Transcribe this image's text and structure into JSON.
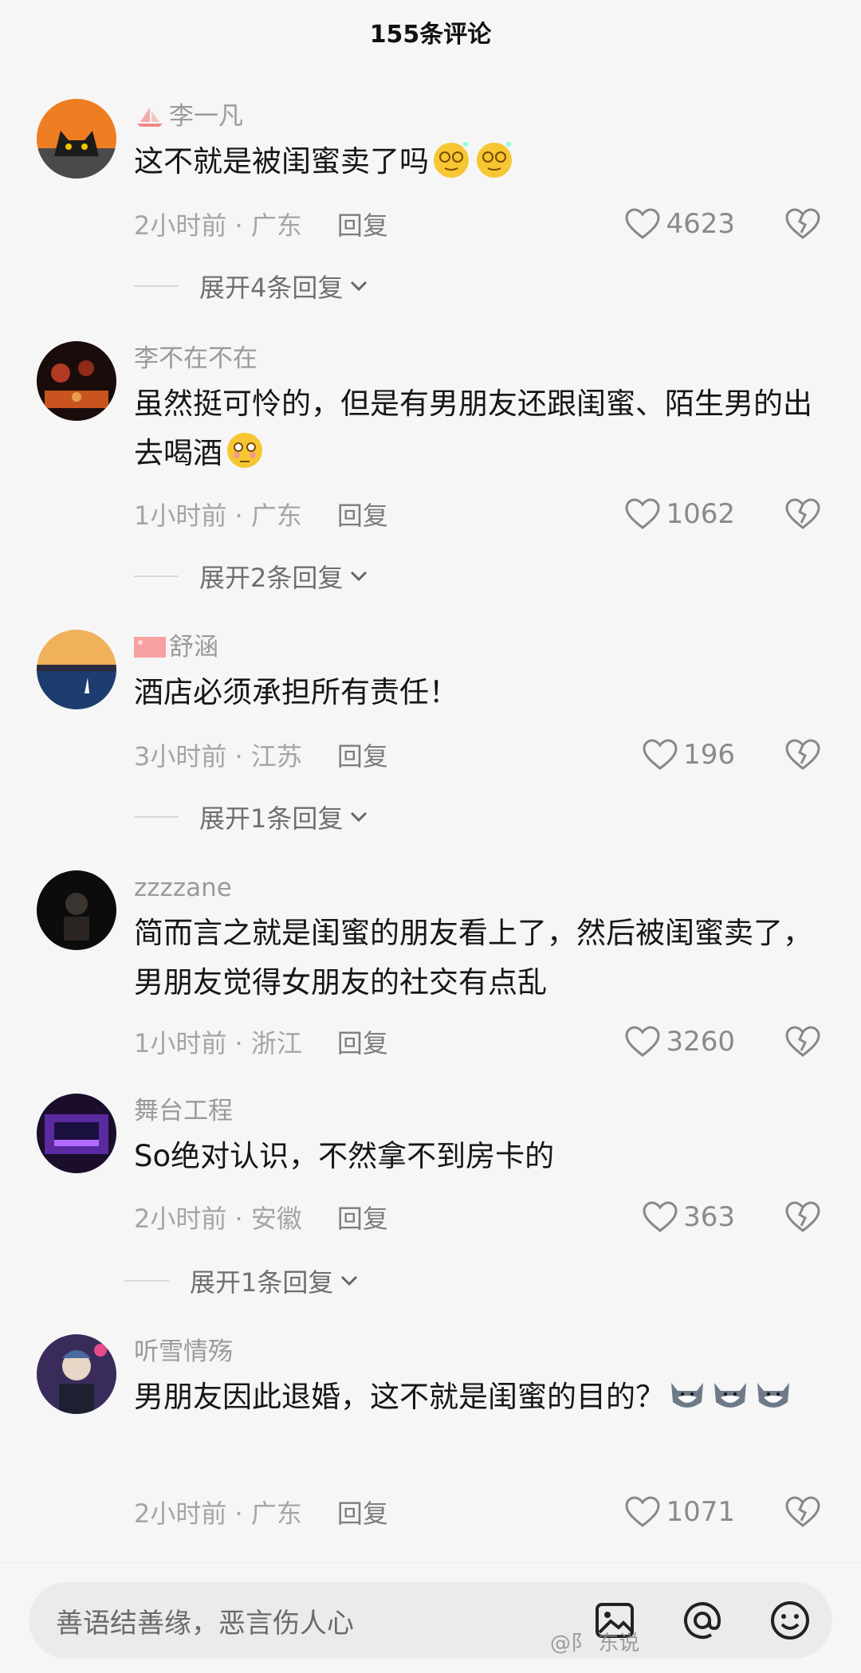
{
  "header": {
    "title": "155条评论"
  },
  "comments": [
    {
      "username": "李一凡",
      "text": "这不就是被闺蜜卖了吗",
      "time": "2小时前 · 广东",
      "reply": "回复",
      "likes": "4623",
      "expand": "展开4条回复"
    },
    {
      "username": "李不在不在",
      "text": "虽然挺可怜的，但是有男朋友还跟闺蜜、陌生男的出去喝酒",
      "time": "1小时前 · 广东",
      "reply": "回复",
      "likes": "1062",
      "expand": "展开2条回复"
    },
    {
      "username": "舒涵",
      "text": "酒店必须承担所有责任！",
      "time": "3小时前 · 江苏",
      "reply": "回复",
      "likes": "196",
      "expand": "展开1条回复"
    },
    {
      "username": "zzzzane",
      "text": "简而言之就是闺蜜的朋友看上了，然后被闺蜜卖了，男朋友觉得女朋友的社交有点乱",
      "time": "1小时前 · 浙江",
      "reply": "回复",
      "likes": "3260"
    },
    {
      "username": "舞台工程",
      "text": "So绝对认识，不然拿不到房卡的",
      "time": "2小时前 · 安徽",
      "reply": "回复",
      "likes": "363",
      "expand": "展开1条回复"
    },
    {
      "username": "听雪情殇",
      "text": "男朋友因此退婚，这不就是闺蜜的目的？",
      "time": "2小时前 · 广东",
      "reply": "回复",
      "likes": "1071"
    }
  ],
  "input": {
    "placeholder": "善语结善缘，恶言伤人心"
  },
  "watermark": "@阝 东说"
}
